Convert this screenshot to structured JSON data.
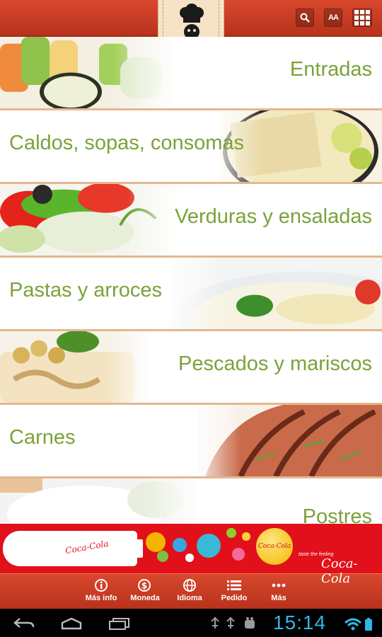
{
  "header": {
    "search_icon": "search-icon",
    "font_size_label": "AA",
    "grid_icon": "grid-icon",
    "logo": "chef-logo"
  },
  "categories": [
    {
      "label": "Entradas",
      "align": "right"
    },
    {
      "label": "Caldos, sopas, consomas",
      "align": "left"
    },
    {
      "label": "Verduras y ensaladas",
      "align": "right"
    },
    {
      "label": "Pastas y arroces",
      "align": "left"
    },
    {
      "label": "Pescados y mariscos",
      "align": "right"
    },
    {
      "label": "Carnes",
      "align": "left"
    },
    {
      "label": "Postres",
      "align": "right"
    }
  ],
  "ad": {
    "brand": "Coca-Cola",
    "bottle_text": "Coca-Cola",
    "disc_text": "Coca-Cola",
    "tagline": "taste the feeling"
  },
  "tabs": [
    {
      "label": "Más info",
      "icon": "info-icon",
      "glyph": "i"
    },
    {
      "label": "Moneda",
      "icon": "currency-icon",
      "glyph": "$"
    },
    {
      "label": "Idioma",
      "icon": "globe-icon",
      "glyph": "◍"
    },
    {
      "label": "Pedido",
      "icon": "list-icon",
      "glyph": "☰"
    },
    {
      "label": "Más",
      "icon": "more-icon",
      "glyph": "•••"
    }
  ],
  "system": {
    "time": "15:14"
  },
  "colors": {
    "accent": "#c8401f",
    "label_green": "#7ba23a",
    "divider": "#e4b78e",
    "ad_red": "#e2101a",
    "clock_blue": "#33b5e5"
  }
}
